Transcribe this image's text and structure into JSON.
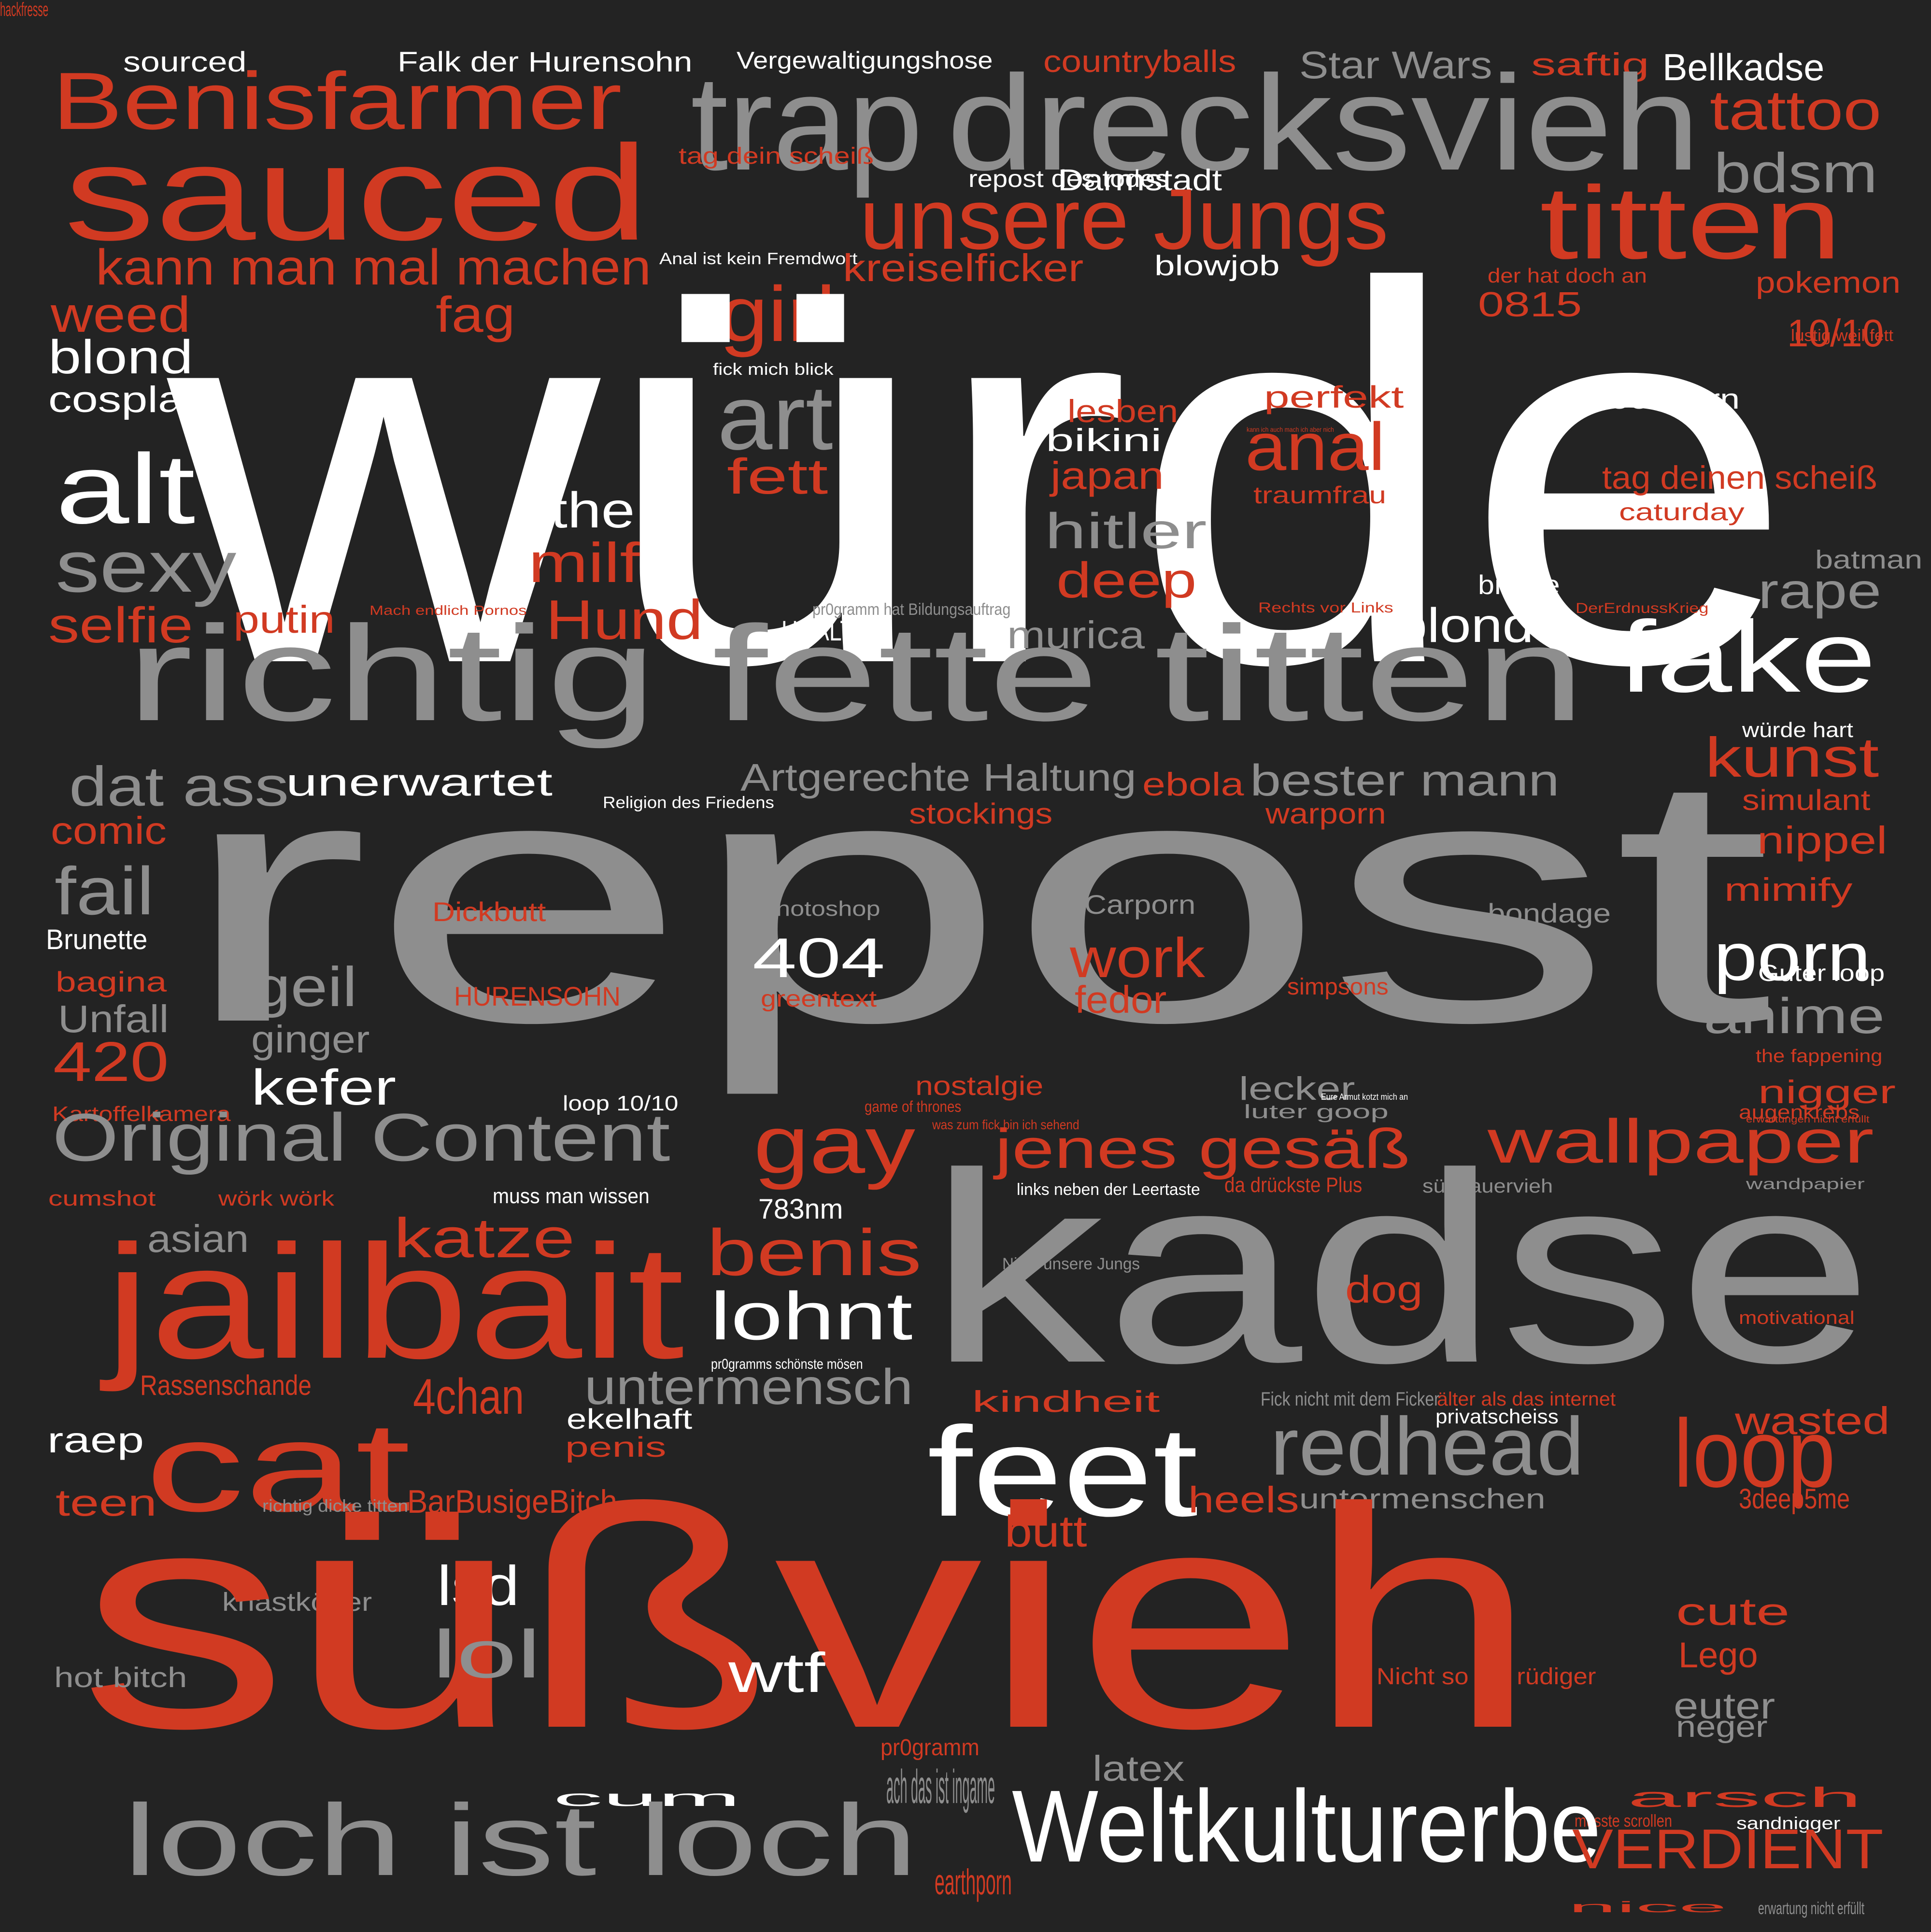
{
  "palette": {
    "background": "#232323",
    "red": "#d13a22",
    "gray": "#8e8e8e",
    "white": "#ffffff"
  },
  "words": [
    {
      "text": "sourced",
      "color": "white"
    },
    {
      "text": "Falk der Hurensohn",
      "color": "white"
    },
    {
      "text": "Vergewaltigungshose",
      "color": "white"
    },
    {
      "text": "countryballs",
      "color": "red"
    },
    {
      "text": "Star Wars",
      "color": "gray"
    },
    {
      "text": "saftig",
      "color": "red"
    },
    {
      "text": "Bellkadse",
      "color": "white"
    },
    {
      "text": "Benisfarmer",
      "color": "red"
    },
    {
      "text": "trap",
      "color": "gray"
    },
    {
      "text": "drecksvieh",
      "color": "gray"
    },
    {
      "text": "tattoo",
      "color": "red"
    },
    {
      "text": "sauced",
      "color": "red"
    },
    {
      "text": "tag dein scheiß",
      "color": "red"
    },
    {
      "text": "repost des todes",
      "color": "white"
    },
    {
      "text": "bdsm",
      "color": "gray"
    },
    {
      "text": "Darmstadt",
      "color": "white"
    },
    {
      "text": "unsere Jungs",
      "color": "red"
    },
    {
      "text": "titten",
      "color": "red"
    },
    {
      "text": "kann man mal machen",
      "color": "red"
    },
    {
      "text": "Anal ist kein Fremdwort",
      "color": "white"
    },
    {
      "text": "kreiselficker",
      "color": "red"
    },
    {
      "text": "blowjob",
      "color": "white"
    },
    {
      "text": "der hat doch an",
      "color": "red"
    },
    {
      "text": "pokemon",
      "color": "red"
    },
    {
      "text": "weed",
      "color": "red"
    },
    {
      "text": "fag",
      "color": "red"
    },
    {
      "text": "girl",
      "color": "red"
    },
    {
      "text": "0815",
      "color": "red"
    },
    {
      "text": "lustig weil fett",
      "color": "red"
    },
    {
      "text": "10/10",
      "color": "red"
    },
    {
      "text": "würde",
      "color": "white"
    },
    {
      "text": "blond",
      "color": "white"
    },
    {
      "text": "fick mich blick",
      "color": "white"
    },
    {
      "text": "cosplay",
      "color": "white"
    },
    {
      "text": "perfekt",
      "color": "red"
    },
    {
      "text": "foodporn",
      "color": "white"
    },
    {
      "text": "art",
      "color": "gray"
    },
    {
      "text": "lesben",
      "color": "red"
    },
    {
      "text": "kann ich auch mach ich aber nich",
      "color": "red"
    },
    {
      "text": "bikini",
      "color": "white"
    },
    {
      "text": "anal",
      "color": "red"
    },
    {
      "text": "alt",
      "color": "white"
    },
    {
      "text": "fett",
      "color": "red"
    },
    {
      "text": "japan",
      "color": "red"
    },
    {
      "text": "tag deinen scheiß",
      "color": "red"
    },
    {
      "text": "the",
      "color": "white"
    },
    {
      "text": "traumfrau",
      "color": "red"
    },
    {
      "text": "caturday",
      "color": "red"
    },
    {
      "text": "hitler",
      "color": "gray"
    },
    {
      "text": "sexy",
      "color": "gray"
    },
    {
      "text": "milf",
      "color": "red"
    },
    {
      "text": "batman",
      "color": "gray"
    },
    {
      "text": "deep",
      "color": "red"
    },
    {
      "text": "brüste",
      "color": "white"
    },
    {
      "text": "rape",
      "color": "gray"
    },
    {
      "text": "selfie",
      "color": "red"
    },
    {
      "text": "putin",
      "color": "red"
    },
    {
      "text": "Mach endlich Pornos",
      "color": "red"
    },
    {
      "text": "Hund",
      "color": "red"
    },
    {
      "text": "pr0gramm hat Bildungsauftrag",
      "color": "gray"
    },
    {
      "text": "Rechts vor Links",
      "color": "red"
    },
    {
      "text": "DerErdnussKrieg",
      "color": "red"
    },
    {
      "text": "URALT",
      "color": "white"
    },
    {
      "text": "murica",
      "color": "gray"
    },
    {
      "text": "blonde",
      "color": "white"
    },
    {
      "text": "richtig fette titten",
      "color": "gray"
    },
    {
      "text": "fake",
      "color": "white"
    },
    {
      "text": "würde hart",
      "color": "white"
    },
    {
      "text": "kunst",
      "color": "red"
    },
    {
      "text": "dat ass",
      "color": "gray"
    },
    {
      "text": "unerwartet",
      "color": "white"
    },
    {
      "text": "Artgerechte Haltung",
      "color": "gray"
    },
    {
      "text": "ebola",
      "color": "red"
    },
    {
      "text": "bester mann",
      "color": "gray"
    },
    {
      "text": "Religion des Friedens",
      "color": "white"
    },
    {
      "text": "stockings",
      "color": "red"
    },
    {
      "text": "warporn",
      "color": "red"
    },
    {
      "text": "simulant",
      "color": "red"
    },
    {
      "text": "comic",
      "color": "red"
    },
    {
      "text": "repost",
      "color": "gray"
    },
    {
      "text": "nippel",
      "color": "red"
    },
    {
      "text": "fail",
      "color": "gray"
    },
    {
      "text": "mimify",
      "color": "red"
    },
    {
      "text": "Dickbutt",
      "color": "red"
    },
    {
      "text": "Photoshop",
      "color": "gray"
    },
    {
      "text": "Carporn",
      "color": "gray"
    },
    {
      "text": "bondage",
      "color": "gray"
    },
    {
      "text": "Brunette",
      "color": "white"
    },
    {
      "text": "porn",
      "color": "white"
    },
    {
      "text": "404",
      "color": "white"
    },
    {
      "text": "work",
      "color": "red"
    },
    {
      "text": "bagina",
      "color": "red"
    },
    {
      "text": "geil",
      "color": "gray"
    },
    {
      "text": "Guter loop",
      "color": "white"
    },
    {
      "text": "simpsons",
      "color": "red"
    },
    {
      "text": "fedor",
      "color": "red"
    },
    {
      "text": "HURENSOHN",
      "color": "red"
    },
    {
      "text": "greentext",
      "color": "red"
    },
    {
      "text": "Unfall",
      "color": "gray"
    },
    {
      "text": "anime",
      "color": "gray"
    },
    {
      "text": "ginger",
      "color": "gray"
    },
    {
      "text": "420",
      "color": "red"
    },
    {
      "text": "the fappening",
      "color": "red"
    },
    {
      "text": "kefer",
      "color": "white"
    },
    {
      "text": "lecker",
      "color": "gray"
    },
    {
      "text": "nostalgie",
      "color": "red"
    },
    {
      "text": "nigger",
      "color": "red"
    },
    {
      "text": "Kartoffelkamera",
      "color": "red"
    },
    {
      "text": "loop 10/10",
      "color": "white"
    },
    {
      "text": "Eure Armut kotzt mich an",
      "color": "white"
    },
    {
      "text": "game of thrones",
      "color": "red"
    },
    {
      "text": "luter goop",
      "color": "gray"
    },
    {
      "text": "augenkrebs",
      "color": "red"
    },
    {
      "text": "erwartungen nicht erfüllt",
      "color": "red"
    },
    {
      "text": "was zum fick bin ich sehend",
      "color": "red"
    },
    {
      "text": "Original Content",
      "color": "gray"
    },
    {
      "text": "gay",
      "color": "red"
    },
    {
      "text": "jenes gesäß",
      "color": "red"
    },
    {
      "text": "wallpaper",
      "color": "red"
    },
    {
      "text": "cumshot",
      "color": "red"
    },
    {
      "text": "wörk wörk",
      "color": "red"
    },
    {
      "text": "muss man wissen",
      "color": "white"
    },
    {
      "text": "links neben der Leertaste",
      "color": "white"
    },
    {
      "text": "da drückste Plus",
      "color": "red"
    },
    {
      "text": "süßsauervieh",
      "color": "gray"
    },
    {
      "text": "wandpapier",
      "color": "gray"
    },
    {
      "text": "783nm",
      "color": "white"
    },
    {
      "text": "katze",
      "color": "red"
    },
    {
      "text": "asian",
      "color": "gray"
    },
    {
      "text": "benis",
      "color": "red"
    },
    {
      "text": "Nicht unsere Jungs",
      "color": "gray"
    },
    {
      "text": "jailbait",
      "color": "red"
    },
    {
      "text": "kadse",
      "color": "gray"
    },
    {
      "text": "dog",
      "color": "red"
    },
    {
      "text": "lohnt",
      "color": "white"
    },
    {
      "text": "motivational",
      "color": "red"
    },
    {
      "text": "pr0gramms schönste mösen",
      "color": "white"
    },
    {
      "text": "Rassenschande",
      "color": "red"
    },
    {
      "text": "untermensch",
      "color": "gray"
    },
    {
      "text": "4chan",
      "color": "red"
    },
    {
      "text": "kindheit",
      "color": "red"
    },
    {
      "text": "Fick nicht mit dem Ficker",
      "color": "gray"
    },
    {
      "text": "älter als das internet",
      "color": "red"
    },
    {
      "text": "wasted",
      "color": "red"
    },
    {
      "text": "ekelhaft",
      "color": "white"
    },
    {
      "text": "privatscheiss",
      "color": "white"
    },
    {
      "text": "raep",
      "color": "white"
    },
    {
      "text": "cat",
      "color": "red"
    },
    {
      "text": "feet",
      "color": "white"
    },
    {
      "text": "redhead",
      "color": "gray"
    },
    {
      "text": "loop",
      "color": "red"
    },
    {
      "text": "penis",
      "color": "red"
    },
    {
      "text": "teen",
      "color": "red"
    },
    {
      "text": "richtig dicke titten",
      "color": "gray"
    },
    {
      "text": "BarBusigeBitch",
      "color": "red"
    },
    {
      "text": "heels",
      "color": "red"
    },
    {
      "text": "untermenschen",
      "color": "gray"
    },
    {
      "text": "3deep5me",
      "color": "red"
    },
    {
      "text": "butt",
      "color": "red"
    },
    {
      "text": "lsd",
      "color": "white"
    },
    {
      "text": "knastköder",
      "color": "gray"
    },
    {
      "text": "cute",
      "color": "red"
    },
    {
      "text": "süßvieh",
      "color": "red"
    },
    {
      "text": "lol",
      "color": "gray"
    },
    {
      "text": "Lego",
      "color": "red"
    },
    {
      "text": "wtf",
      "color": "white"
    },
    {
      "text": "hot bitch",
      "color": "gray"
    },
    {
      "text": "Nicht so tief rüdiger",
      "color": "red"
    },
    {
      "text": "euter",
      "color": "gray"
    },
    {
      "text": "neger",
      "color": "gray"
    },
    {
      "text": "pr0gramm",
      "color": "red"
    },
    {
      "text": "latex",
      "color": "gray"
    },
    {
      "text": "cum",
      "color": "white"
    },
    {
      "text": "ach das ist ingame",
      "color": "gray"
    },
    {
      "text": "arsch",
      "color": "red"
    },
    {
      "text": "musste scrollen",
      "color": "red"
    },
    {
      "text": "sandnigger",
      "color": "white"
    },
    {
      "text": "loch ist loch",
      "color": "gray"
    },
    {
      "text": "Weltkulturerbe",
      "color": "white"
    },
    {
      "text": "VERDIENT",
      "color": "red"
    },
    {
      "text": "earthporn",
      "color": "red"
    },
    {
      "text": "nice",
      "color": "red"
    },
    {
      "text": "erwartung nicht erfüllt",
      "color": "gray"
    },
    {
      "text": "hackfresse",
      "color": "red"
    }
  ]
}
